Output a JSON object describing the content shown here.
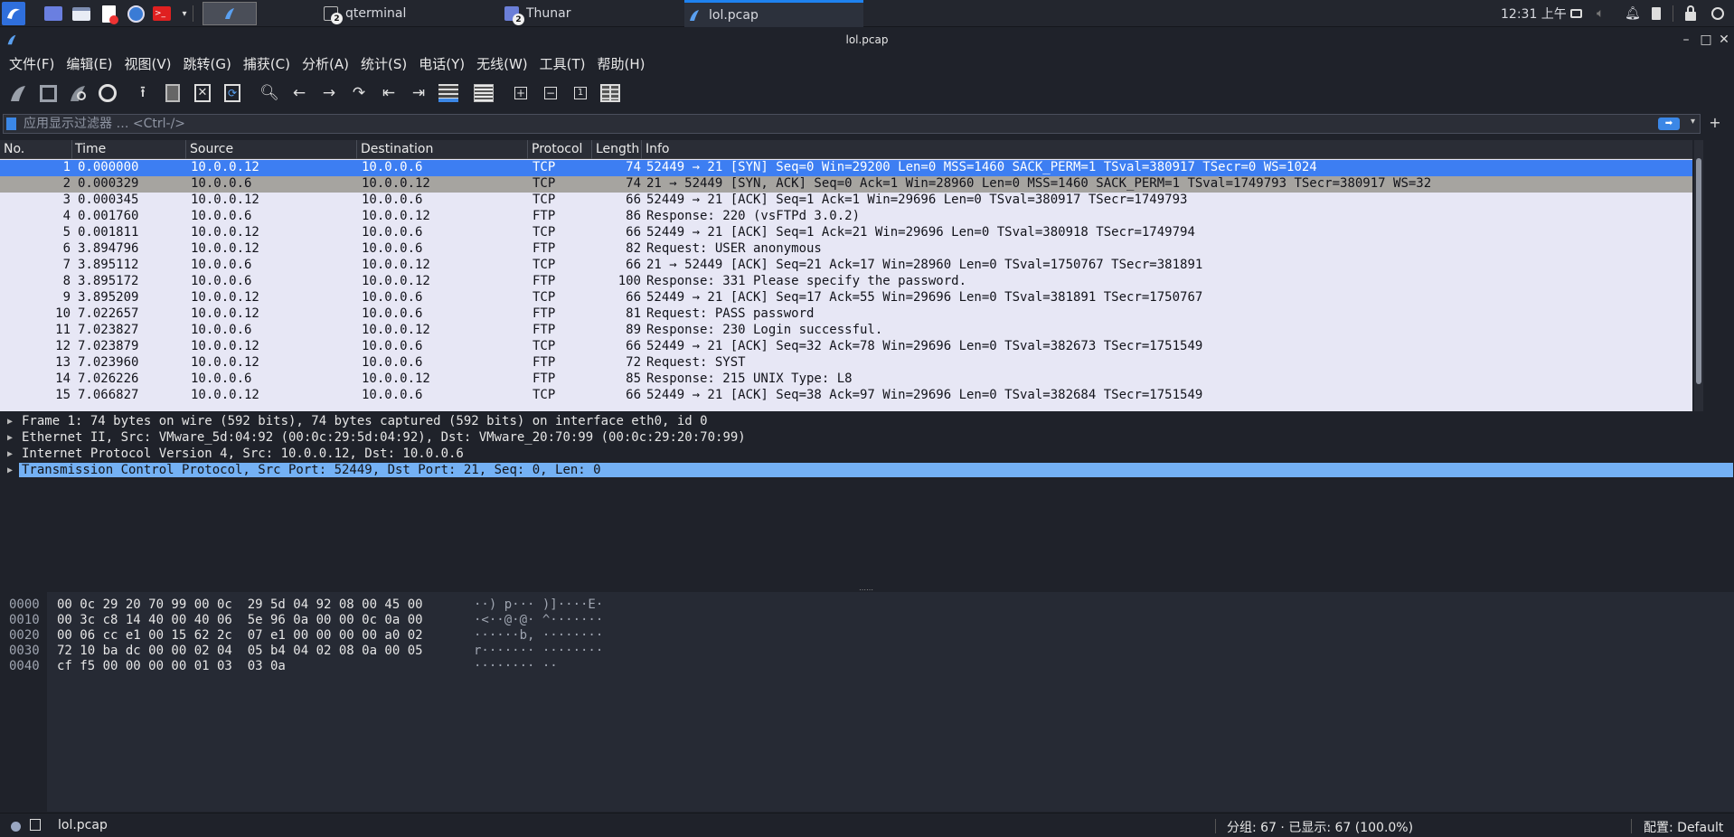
{
  "taskbar": {
    "tasks": [
      {
        "label": "qterminal",
        "badge": "2"
      },
      {
        "label": "Thunar",
        "badge": "2"
      },
      {
        "label": "lol.pcap",
        "badge": ""
      }
    ],
    "clock": "12:31 上午"
  },
  "window": {
    "title": "lol.pcap"
  },
  "menu": [
    "文件(F)",
    "编辑(E)",
    "视图(V)",
    "跳转(G)",
    "捕获(C)",
    "分析(A)",
    "统计(S)",
    "电话(Y)",
    "无线(W)",
    "工具(T)",
    "帮助(H)"
  ],
  "filter": {
    "placeholder": "应用显示过滤器 … <Ctrl-/>"
  },
  "packet_list": {
    "columns": [
      "No.",
      "Time",
      "Source",
      "Destination",
      "Protocol",
      "Length",
      "Info"
    ],
    "rows": [
      {
        "no": "1",
        "time": "0.000000",
        "src": "10.0.0.12",
        "dst": "10.0.0.6",
        "proto": "TCP",
        "len": "74",
        "info": "52449 → 21 [SYN] Seq=0 Win=29200 Len=0 MSS=1460 SACK_PERM=1 TSval=380917 TSecr=0 WS=1024"
      },
      {
        "no": "2",
        "time": "0.000329",
        "src": "10.0.0.6",
        "dst": "10.0.0.12",
        "proto": "TCP",
        "len": "74",
        "info": "21 → 52449 [SYN, ACK] Seq=0 Ack=1 Win=28960 Len=0 MSS=1460 SACK_PERM=1 TSval=1749793 TSecr=380917 WS=32"
      },
      {
        "no": "3",
        "time": "0.000345",
        "src": "10.0.0.12",
        "dst": "10.0.0.6",
        "proto": "TCP",
        "len": "66",
        "info": "52449 → 21 [ACK] Seq=1 Ack=1 Win=29696 Len=0 TSval=380917 TSecr=1749793"
      },
      {
        "no": "4",
        "time": "0.001760",
        "src": "10.0.0.6",
        "dst": "10.0.0.12",
        "proto": "FTP",
        "len": "86",
        "info": "Response: 220 (vsFTPd 3.0.2)"
      },
      {
        "no": "5",
        "time": "0.001811",
        "src": "10.0.0.12",
        "dst": "10.0.0.6",
        "proto": "TCP",
        "len": "66",
        "info": "52449 → 21 [ACK] Seq=1 Ack=21 Win=29696 Len=0 TSval=380918 TSecr=1749794"
      },
      {
        "no": "6",
        "time": "3.894796",
        "src": "10.0.0.12",
        "dst": "10.0.0.6",
        "proto": "FTP",
        "len": "82",
        "info": "Request: USER anonymous"
      },
      {
        "no": "7",
        "time": "3.895112",
        "src": "10.0.0.6",
        "dst": "10.0.0.12",
        "proto": "TCP",
        "len": "66",
        "info": "21 → 52449 [ACK] Seq=21 Ack=17 Win=28960 Len=0 TSval=1750767 TSecr=381891"
      },
      {
        "no": "8",
        "time": "3.895172",
        "src": "10.0.0.6",
        "dst": "10.0.0.12",
        "proto": "FTP",
        "len": "100",
        "info": "Response: 331 Please specify the password."
      },
      {
        "no": "9",
        "time": "3.895209",
        "src": "10.0.0.12",
        "dst": "10.0.0.6",
        "proto": "TCP",
        "len": "66",
        "info": "52449 → 21 [ACK] Seq=17 Ack=55 Win=29696 Len=0 TSval=381891 TSecr=1750767"
      },
      {
        "no": "10",
        "time": "7.022657",
        "src": "10.0.0.12",
        "dst": "10.0.0.6",
        "proto": "FTP",
        "len": "81",
        "info": "Request: PASS password"
      },
      {
        "no": "11",
        "time": "7.023827",
        "src": "10.0.0.6",
        "dst": "10.0.0.12",
        "proto": "FTP",
        "len": "89",
        "info": "Response: 230 Login successful."
      },
      {
        "no": "12",
        "time": "7.023879",
        "src": "10.0.0.12",
        "dst": "10.0.0.6",
        "proto": "TCP",
        "len": "66",
        "info": "52449 → 21 [ACK] Seq=32 Ack=78 Win=29696 Len=0 TSval=382673 TSecr=1751549"
      },
      {
        "no": "13",
        "time": "7.023960",
        "src": "10.0.0.12",
        "dst": "10.0.0.6",
        "proto": "FTP",
        "len": "72",
        "info": "Request: SYST"
      },
      {
        "no": "14",
        "time": "7.026226",
        "src": "10.0.0.6",
        "dst": "10.0.0.12",
        "proto": "FTP",
        "len": "85",
        "info": "Response: 215 UNIX Type: L8"
      },
      {
        "no": "15",
        "time": "7.066827",
        "src": "10.0.0.12",
        "dst": "10.0.0.6",
        "proto": "TCP",
        "len": "66",
        "info": "52449 → 21 [ACK] Seq=38 Ack=97 Win=29696 Len=0 TSval=382684 TSecr=1751549"
      }
    ]
  },
  "details": [
    "Frame 1: 74 bytes on wire (592 bits), 74 bytes captured (592 bits) on interface eth0, id 0",
    "Ethernet II, Src: VMware_5d:04:92 (00:0c:29:5d:04:92), Dst: VMware_20:70:99 (00:0c:29:20:70:99)",
    "Internet Protocol Version 4, Src: 10.0.0.12, Dst: 10.0.0.6",
    "Transmission Control Protocol, Src Port: 52449, Dst Port: 21, Seq: 0, Len: 0"
  ],
  "bytes": [
    {
      "offset": "0000",
      "hex": "00 0c 29 20 70 99 00 0c  29 5d 04 92 08 00 45 00",
      "ascii": "··) p··· )]····E·"
    },
    {
      "offset": "0010",
      "hex": "00 3c c8 14 40 00 40 06  5e 96 0a 00 00 0c 0a 00",
      "ascii": "·<··@·@· ^·······"
    },
    {
      "offset": "0020",
      "hex": "00 06 cc e1 00 15 62 2c  07 e1 00 00 00 00 a0 02",
      "ascii": "······b, ········"
    },
    {
      "offset": "0030",
      "hex": "72 10 ba dc 00 00 02 04  05 b4 04 02 08 0a 00 05",
      "ascii": "r······· ········"
    },
    {
      "offset": "0040",
      "hex": "cf f5 00 00 00 00 01 03  03 0a",
      "ascii": "········ ··"
    }
  ],
  "status": {
    "file": "lol.pcap",
    "counts": "分组: 67 · 已显示: 67 (100.0%)",
    "profile": "配置: Default"
  }
}
